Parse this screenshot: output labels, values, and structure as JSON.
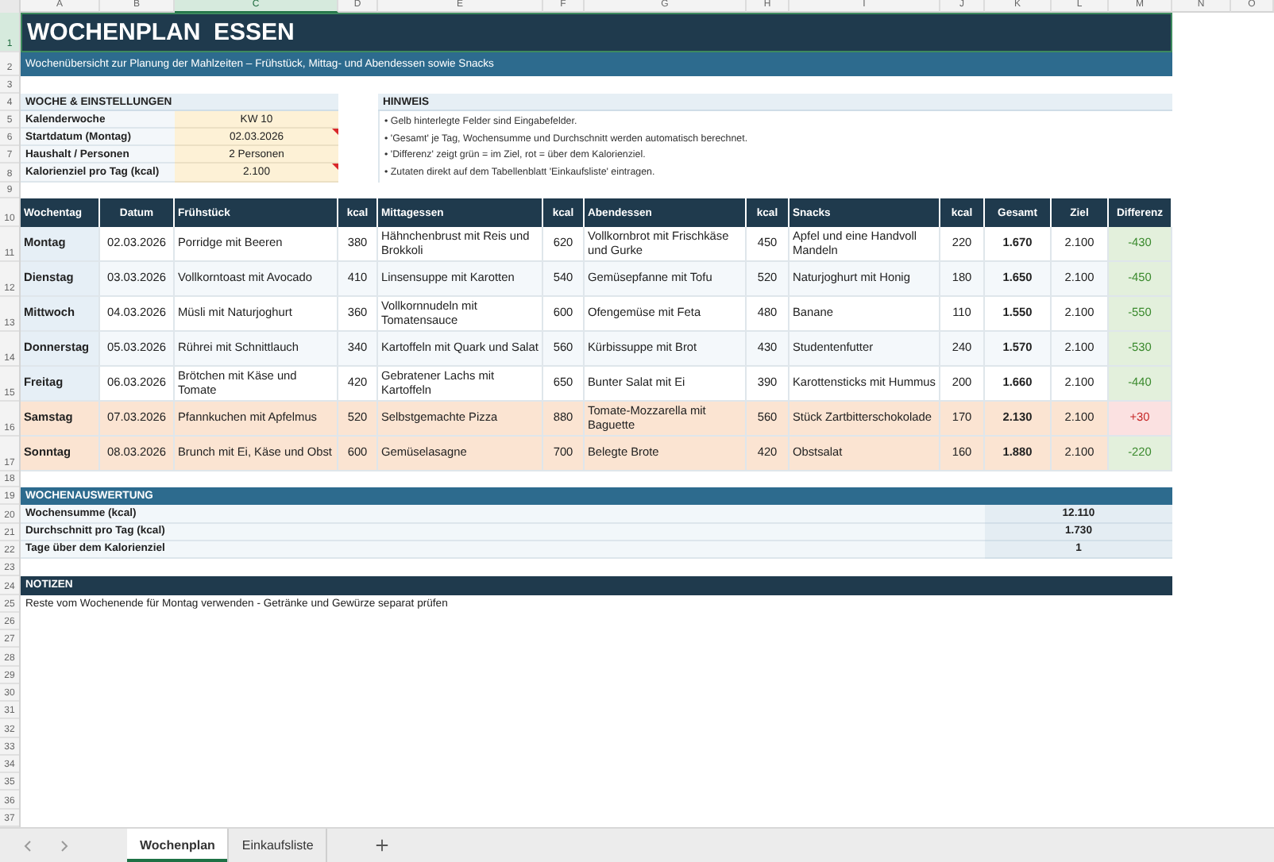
{
  "column_letters": [
    {
      "label": "A",
      "selected": false
    },
    {
      "label": "B",
      "selected": false
    },
    {
      "label": "C",
      "selected": true
    },
    {
      "label": "D",
      "selected": false
    },
    {
      "label": "E",
      "selected": false
    },
    {
      "label": "F",
      "selected": false
    },
    {
      "label": "G",
      "selected": false
    },
    {
      "label": "H",
      "selected": false
    },
    {
      "label": "I",
      "selected": false
    },
    {
      "label": "J",
      "selected": false
    },
    {
      "label": "K",
      "selected": false
    },
    {
      "label": "L",
      "selected": false
    },
    {
      "label": "M",
      "selected": false
    },
    {
      "label": "N",
      "selected": false
    },
    {
      "label": "O",
      "selected": false
    }
  ],
  "row_numbers": [
    {
      "label": "1",
      "selected": true
    },
    {
      "label": "2",
      "selected": false
    },
    {
      "label": "3",
      "selected": false
    },
    {
      "label": "4",
      "selected": false
    },
    {
      "label": "5",
      "selected": false
    },
    {
      "label": "6",
      "selected": false
    },
    {
      "label": "7",
      "selected": false
    },
    {
      "label": "8",
      "selected": false
    },
    {
      "label": "9",
      "selected": false
    },
    {
      "label": "10",
      "selected": false
    },
    {
      "label": "11",
      "selected": false
    },
    {
      "label": "12",
      "selected": false
    },
    {
      "label": "13",
      "selected": false
    },
    {
      "label": "14",
      "selected": false
    },
    {
      "label": "15",
      "selected": false
    },
    {
      "label": "16",
      "selected": false
    },
    {
      "label": "17",
      "selected": false
    },
    {
      "label": "18",
      "selected": false
    },
    {
      "label": "19",
      "selected": false
    },
    {
      "label": "20",
      "selected": false
    },
    {
      "label": "21",
      "selected": false
    },
    {
      "label": "22",
      "selected": false
    },
    {
      "label": "23",
      "selected": false
    },
    {
      "label": "24",
      "selected": false
    },
    {
      "label": "25",
      "selected": false
    },
    {
      "label": "26",
      "selected": false
    },
    {
      "label": "27",
      "selected": false
    },
    {
      "label": "28",
      "selected": false
    },
    {
      "label": "29",
      "selected": false
    },
    {
      "label": "30",
      "selected": false
    },
    {
      "label": "31",
      "selected": false
    },
    {
      "label": "32",
      "selected": false
    },
    {
      "label": "33",
      "selected": false
    },
    {
      "label": "34",
      "selected": false
    },
    {
      "label": "35",
      "selected": false
    },
    {
      "label": "36",
      "selected": false
    },
    {
      "label": "37",
      "selected": false
    }
  ],
  "title": "WOCHENPLAN  ESSEN",
  "subtitle": "Wochenübersicht zur Planung der Mahlzeiten – Frühstück, Mittag- und Abendessen sowie Snacks",
  "settings": {
    "heading": "WOCHE & EINSTELLUNGEN",
    "rows": [
      {
        "label": "Kalenderwoche",
        "value": "KW 10",
        "has_comment": false
      },
      {
        "label": "Startdatum (Montag)",
        "value": "02.03.2026",
        "has_comment": true
      },
      {
        "label": "Haushalt / Personen",
        "value": "2 Personen",
        "has_comment": false
      },
      {
        "label": "Kalorienziel pro Tag (kcal)",
        "value": "2.100",
        "has_comment": true
      }
    ]
  },
  "hint": {
    "heading": "HINWEIS",
    "lines": [
      "• Gelb hinterlegte Felder sind Eingabefelder.",
      "• 'Gesamt' je Tag, Wochensumme und Durchschnitt werden automatisch berechnet.",
      "• 'Differenz' zeigt grün = im Ziel, rot = über dem Kalorienziel.",
      "• Zutaten direkt auf dem Tabellenblatt 'Einkaufsliste' eintragen."
    ]
  },
  "meal_table": {
    "columns": [
      "Wochentag",
      "Datum",
      "Frühstück",
      "kcal",
      "Mittagessen",
      "kcal",
      "Abendessen",
      "kcal",
      "Snacks",
      "kcal",
      "Gesamt",
      "Ziel",
      "Differenz"
    ],
    "rows": [
      {
        "day": "Montag",
        "date": "02.03.2026",
        "breakfast": "Porridge mit Beeren",
        "breakfast_kcal": "380",
        "lunch": "Hähnchenbrust mit Reis und Brokkoli",
        "lunch_kcal": "620",
        "dinner": "Vollkornbrot mit Frischkäse und Gurke",
        "dinner_kcal": "450",
        "snack": "Apfel und eine Handvoll Mandeln",
        "snack_kcal": "220",
        "total": "1.670",
        "target": "2.100",
        "difference": "-430",
        "weekend": false,
        "over_target": false
      },
      {
        "day": "Dienstag",
        "date": "03.03.2026",
        "breakfast": "Vollkorntoast mit Avocado",
        "breakfast_kcal": "410",
        "lunch": "Linsensuppe mit Karotten",
        "lunch_kcal": "540",
        "dinner": "Gemüsepfanne mit Tofu",
        "dinner_kcal": "520",
        "snack": "Naturjoghurt mit Honig",
        "snack_kcal": "180",
        "total": "1.650",
        "target": "2.100",
        "difference": "-450",
        "weekend": false,
        "over_target": false
      },
      {
        "day": "Mittwoch",
        "date": "04.03.2026",
        "breakfast": "Müsli mit Naturjoghurt",
        "breakfast_kcal": "360",
        "lunch": "Vollkornnudeln mit Tomatensauce",
        "lunch_kcal": "600",
        "dinner": "Ofengemüse mit Feta",
        "dinner_kcal": "480",
        "snack": "Banane",
        "snack_kcal": "110",
        "total": "1.550",
        "target": "2.100",
        "difference": "-550",
        "weekend": false,
        "over_target": false
      },
      {
        "day": "Donnerstag",
        "date": "05.03.2026",
        "breakfast": "Rührei mit Schnittlauch",
        "breakfast_kcal": "340",
        "lunch": "Kartoffeln mit Quark und Salat",
        "lunch_kcal": "560",
        "dinner": "Kürbissuppe mit Brot",
        "dinner_kcal": "430",
        "snack": "Studentenfutter",
        "snack_kcal": "240",
        "total": "1.570",
        "target": "2.100",
        "difference": "-530",
        "weekend": false,
        "over_target": false
      },
      {
        "day": "Freitag",
        "date": "06.03.2026",
        "breakfast": "Brötchen mit Käse und Tomate",
        "breakfast_kcal": "420",
        "lunch": "Gebratener Lachs mit Kartoffeln",
        "lunch_kcal": "650",
        "dinner": "Bunter Salat mit Ei",
        "dinner_kcal": "390",
        "snack": "Karottensticks mit Hummus",
        "snack_kcal": "200",
        "total": "1.660",
        "target": "2.100",
        "difference": "-440",
        "weekend": false,
        "over_target": false
      },
      {
        "day": "Samstag",
        "date": "07.03.2026",
        "breakfast": "Pfannkuchen mit Apfelmus",
        "breakfast_kcal": "520",
        "lunch": "Selbstgemachte Pizza",
        "lunch_kcal": "880",
        "dinner": "Tomate-Mozzarella mit Baguette",
        "dinner_kcal": "560",
        "snack": "Stück Zartbitterschokolade",
        "snack_kcal": "170",
        "total": "2.130",
        "target": "2.100",
        "difference": "+30",
        "weekend": true,
        "over_target": true
      },
      {
        "day": "Sonntag",
        "date": "08.03.2026",
        "breakfast": "Brunch mit Ei, Käse und Obst",
        "breakfast_kcal": "600",
        "lunch": "Gemüselasagne",
        "lunch_kcal": "700",
        "dinner": "Belegte Brote",
        "dinner_kcal": "420",
        "snack": "Obstsalat",
        "snack_kcal": "160",
        "total": "1.880",
        "target": "2.100",
        "difference": "-220",
        "weekend": true,
        "over_target": false
      }
    ]
  },
  "summary": {
    "heading": "WOCHENAUSWERTUNG",
    "rows": [
      {
        "label": "Wochensumme (kcal)",
        "value": "12.110"
      },
      {
        "label": "Durchschnitt pro Tag (kcal)",
        "value": "1.730"
      },
      {
        "label": "Tage über dem Kalorienziel",
        "value": "1"
      }
    ]
  },
  "notes": {
    "heading": "NOTIZEN",
    "text": "Reste vom Wochenende für Montag verwenden - Getränke und Gewürze separat prüfen"
  },
  "sheet_tabs": [
    {
      "label": "Wochenplan",
      "selected": true
    },
    {
      "label": "Einkaufsliste",
      "selected": false
    }
  ]
}
